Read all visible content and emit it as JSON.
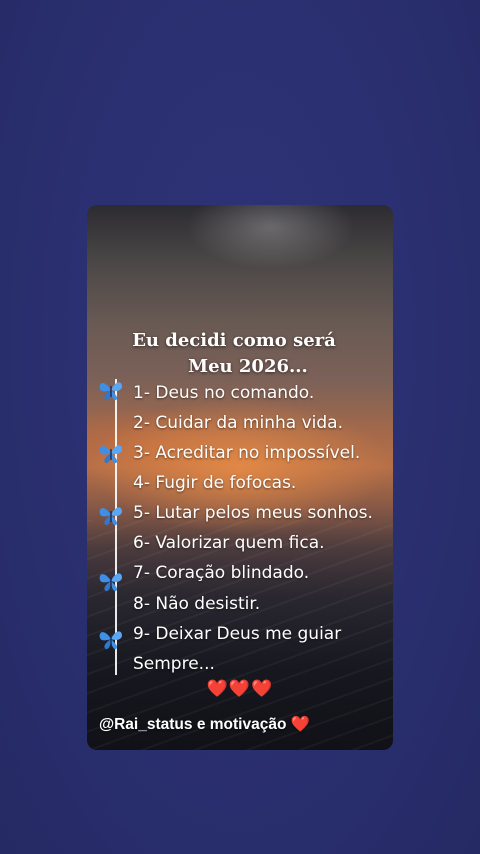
{
  "card": {
    "title_line1": "Eu decidi como será",
    "title_line2": "Meu 2026...",
    "items": [
      "1- Deus no comando.",
      "2- Cuidar da minha vida.",
      "3- Acreditar no impossível.",
      "4- Fugir de fofocas.",
      "5- Lutar pelos meus sonhos.",
      "6- Valorizar quem fica.",
      "7- Coração blindado.",
      "8- Não desistir.",
      "9- Deixar Deus me guiar",
      "Sempre..."
    ],
    "hearts": "❤️❤️❤️",
    "signature": "@Rai_status e motivação",
    "signature_heart": "❤️"
  },
  "icons": {
    "butterfly": "butterfly-icon",
    "heart": "heart-icon"
  },
  "colors": {
    "background": "#2a2f70",
    "butterfly": "#3d8fe8",
    "heart": "#e8211f",
    "text": "#ffffff"
  }
}
